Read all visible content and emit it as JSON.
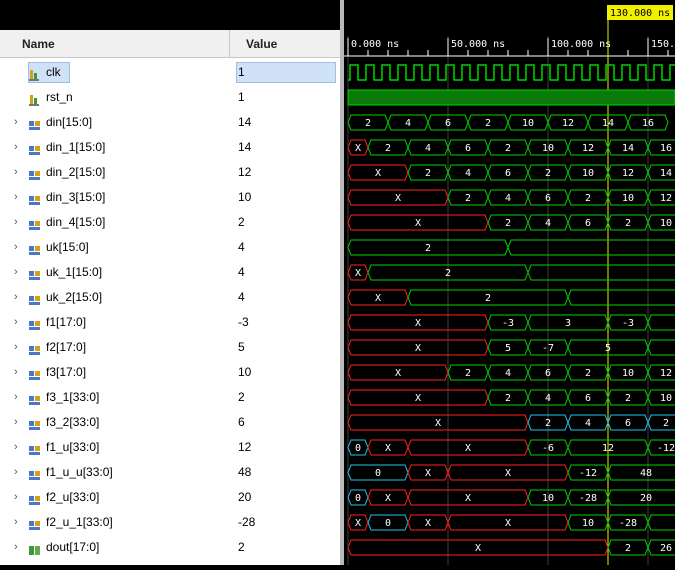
{
  "headers": {
    "name": "Name",
    "value": "Value"
  },
  "cursor_time": "130.000 ns",
  "time_ticks": [
    "0.000 ns",
    "50.000 ns",
    "100.000 ns",
    "150."
  ],
  "colors": {
    "wave_green": "#00d400",
    "wave_red": "#ff2020",
    "wave_cyan": "#21c8e6",
    "cursor_yellow": "#f0f000",
    "grid": "#3c3c3c"
  },
  "signals": [
    {
      "name": "clk",
      "value": "1",
      "icon": "bit-signal-icon",
      "expandable": false,
      "selected": true,
      "wave": {
        "kind": "clock",
        "period": 8.0,
        "start": 1.0
      }
    },
    {
      "name": "rst_n",
      "value": "1",
      "icon": "bit-signal-icon",
      "expandable": false,
      "wave": {
        "kind": "level"
      }
    },
    {
      "name": "din[15:0]",
      "value": "14",
      "icon": "bus-signal-icon",
      "expandable": true,
      "wave": {
        "kind": "bus",
        "segments": [
          {
            "s": 0,
            "e": 20,
            "v": "2",
            "c": "g"
          },
          {
            "s": 20,
            "e": 40,
            "v": "4",
            "c": "g"
          },
          {
            "s": 40,
            "e": 60,
            "v": "6",
            "c": "g"
          },
          {
            "s": 60,
            "e": 80,
            "v": "2",
            "c": "g"
          },
          {
            "s": 80,
            "e": 100,
            "v": "10",
            "c": "g"
          },
          {
            "s": 100,
            "e": 120,
            "v": "12",
            "c": "g"
          },
          {
            "s": 120,
            "e": 140,
            "v": "14",
            "c": "g"
          },
          {
            "s": 140,
            "e": 160,
            "v": "16",
            "c": "g"
          }
        ]
      }
    },
    {
      "name": "din_1[15:0]",
      "value": "14",
      "icon": "bus-signal-icon",
      "expandable": true,
      "wave": {
        "kind": "bus",
        "segments": [
          {
            "s": 0,
            "e": 10,
            "v": "X",
            "c": "r"
          },
          {
            "s": 10,
            "e": 30,
            "v": "2",
            "c": "g"
          },
          {
            "s": 30,
            "e": 50,
            "v": "4",
            "c": "g"
          },
          {
            "s": 50,
            "e": 70,
            "v": "6",
            "c": "g"
          },
          {
            "s": 70,
            "e": 90,
            "v": "2",
            "c": "g"
          },
          {
            "s": 90,
            "e": 110,
            "v": "10",
            "c": "g"
          },
          {
            "s": 110,
            "e": 130,
            "v": "12",
            "c": "g"
          },
          {
            "s": 130,
            "e": 150,
            "v": "14",
            "c": "g"
          },
          {
            "s": 150,
            "e": 170,
            "v": "16",
            "c": "g"
          }
        ]
      }
    },
    {
      "name": "din_2[15:0]",
      "value": "12",
      "icon": "bus-signal-icon",
      "expandable": true,
      "wave": {
        "kind": "bus",
        "segments": [
          {
            "s": 0,
            "e": 30,
            "v": "X",
            "c": "r"
          },
          {
            "s": 30,
            "e": 50,
            "v": "2",
            "c": "g"
          },
          {
            "s": 50,
            "e": 70,
            "v": "4",
            "c": "g"
          },
          {
            "s": 70,
            "e": 90,
            "v": "6",
            "c": "g"
          },
          {
            "s": 90,
            "e": 110,
            "v": "2",
            "c": "g"
          },
          {
            "s": 110,
            "e": 130,
            "v": "10",
            "c": "g"
          },
          {
            "s": 130,
            "e": 150,
            "v": "12",
            "c": "g"
          },
          {
            "s": 150,
            "e": 170,
            "v": "14",
            "c": "g"
          }
        ]
      }
    },
    {
      "name": "din_3[15:0]",
      "value": "10",
      "icon": "bus-signal-icon",
      "expandable": true,
      "wave": {
        "kind": "bus",
        "segments": [
          {
            "s": 0,
            "e": 50,
            "v": "X",
            "c": "r"
          },
          {
            "s": 50,
            "e": 70,
            "v": "2",
            "c": "g"
          },
          {
            "s": 70,
            "e": 90,
            "v": "4",
            "c": "g"
          },
          {
            "s": 90,
            "e": 110,
            "v": "6",
            "c": "g"
          },
          {
            "s": 110,
            "e": 130,
            "v": "2",
            "c": "g"
          },
          {
            "s": 130,
            "e": 150,
            "v": "10",
            "c": "g"
          },
          {
            "s": 150,
            "e": 170,
            "v": "12",
            "c": "g"
          }
        ]
      }
    },
    {
      "name": "din_4[15:0]",
      "value": "2",
      "icon": "bus-signal-icon",
      "expandable": true,
      "wave": {
        "kind": "bus",
        "segments": [
          {
            "s": 0,
            "e": 70,
            "v": "X",
            "c": "r"
          },
          {
            "s": 70,
            "e": 90,
            "v": "2",
            "c": "g"
          },
          {
            "s": 90,
            "e": 110,
            "v": "4",
            "c": "g"
          },
          {
            "s": 110,
            "e": 130,
            "v": "6",
            "c": "g"
          },
          {
            "s": 130,
            "e": 150,
            "v": "2",
            "c": "g"
          },
          {
            "s": 150,
            "e": 170,
            "v": "10",
            "c": "g"
          }
        ]
      }
    },
    {
      "name": "uk[15:0]",
      "value": "4",
      "icon": "bus-signal-icon",
      "expandable": true,
      "wave": {
        "kind": "bus",
        "segments": [
          {
            "s": 0,
            "e": 80,
            "v": "2",
            "c": "g"
          },
          {
            "s": 80,
            "e": 170,
            "v": "",
            "c": "g"
          }
        ]
      }
    },
    {
      "name": "uk_1[15:0]",
      "value": "4",
      "icon": "bus-signal-icon",
      "expandable": true,
      "wave": {
        "kind": "bus",
        "segments": [
          {
            "s": 0,
            "e": 10,
            "v": "X",
            "c": "r"
          },
          {
            "s": 10,
            "e": 90,
            "v": "2",
            "c": "g"
          },
          {
            "s": 90,
            "e": 170,
            "v": "",
            "c": "g"
          }
        ]
      }
    },
    {
      "name": "uk_2[15:0]",
      "value": "4",
      "icon": "bus-signal-icon",
      "expandable": true,
      "wave": {
        "kind": "bus",
        "segments": [
          {
            "s": 0,
            "e": 30,
            "v": "X",
            "c": "r"
          },
          {
            "s": 30,
            "e": 110,
            "v": "2",
            "c": "g"
          },
          {
            "s": 110,
            "e": 170,
            "v": "",
            "c": "g"
          }
        ]
      }
    },
    {
      "name": "f1[17:0]",
      "value": "-3",
      "icon": "bus-signal-icon",
      "expandable": true,
      "wave": {
        "kind": "bus",
        "segments": [
          {
            "s": 0,
            "e": 70,
            "v": "X",
            "c": "r"
          },
          {
            "s": 70,
            "e": 90,
            "v": "-3",
            "c": "g"
          },
          {
            "s": 90,
            "e": 130,
            "v": "3",
            "c": "g"
          },
          {
            "s": 130,
            "e": 150,
            "v": "-3",
            "c": "g"
          },
          {
            "s": 150,
            "e": 170,
            "v": "",
            "c": "g"
          }
        ]
      }
    },
    {
      "name": "f2[17:0]",
      "value": "5",
      "icon": "bus-signal-icon",
      "expandable": true,
      "wave": {
        "kind": "bus",
        "segments": [
          {
            "s": 0,
            "e": 70,
            "v": "X",
            "c": "r"
          },
          {
            "s": 70,
            "e": 90,
            "v": "5",
            "c": "g"
          },
          {
            "s": 90,
            "e": 110,
            "v": "-7",
            "c": "g"
          },
          {
            "s": 110,
            "e": 150,
            "v": "5",
            "c": "g"
          },
          {
            "s": 150,
            "e": 170,
            "v": "",
            "c": "g"
          }
        ]
      }
    },
    {
      "name": "f3[17:0]",
      "value": "10",
      "icon": "bus-signal-icon",
      "expandable": true,
      "wave": {
        "kind": "bus",
        "segments": [
          {
            "s": 0,
            "e": 50,
            "v": "X",
            "c": "r"
          },
          {
            "s": 50,
            "e": 70,
            "v": "2",
            "c": "g"
          },
          {
            "s": 70,
            "e": 90,
            "v": "4",
            "c": "g"
          },
          {
            "s": 90,
            "e": 110,
            "v": "6",
            "c": "g"
          },
          {
            "s": 110,
            "e": 130,
            "v": "2",
            "c": "g"
          },
          {
            "s": 130,
            "e": 150,
            "v": "10",
            "c": "g"
          },
          {
            "s": 150,
            "e": 170,
            "v": "12",
            "c": "g"
          }
        ]
      }
    },
    {
      "name": "f3_1[33:0]",
      "value": "2",
      "icon": "bus-signal-icon",
      "expandable": true,
      "wave": {
        "kind": "bus",
        "segments": [
          {
            "s": 0,
            "e": 70,
            "v": "X",
            "c": "r"
          },
          {
            "s": 70,
            "e": 90,
            "v": "2",
            "c": "g"
          },
          {
            "s": 90,
            "e": 110,
            "v": "4",
            "c": "g"
          },
          {
            "s": 110,
            "e": 130,
            "v": "6",
            "c": "g"
          },
          {
            "s": 130,
            "e": 150,
            "v": "2",
            "c": "g"
          },
          {
            "s": 150,
            "e": 170,
            "v": "10",
            "c": "g"
          }
        ]
      }
    },
    {
      "name": "f3_2[33:0]",
      "value": "6",
      "icon": "bus-signal-icon",
      "expandable": true,
      "wave": {
        "kind": "bus",
        "segments": [
          {
            "s": 0,
            "e": 90,
            "v": "X",
            "c": "r"
          },
          {
            "s": 90,
            "e": 110,
            "v": "2",
            "c": "c"
          },
          {
            "s": 110,
            "e": 130,
            "v": "4",
            "c": "c"
          },
          {
            "s": 130,
            "e": 150,
            "v": "6",
            "c": "c"
          },
          {
            "s": 150,
            "e": 170,
            "v": "2",
            "c": "c"
          }
        ]
      }
    },
    {
      "name": "f1_u[33:0]",
      "value": "12",
      "icon": "bus-signal-icon",
      "expandable": true,
      "wave": {
        "kind": "bus",
        "segments": [
          {
            "s": 0,
            "e": 10,
            "v": "0",
            "c": "c"
          },
          {
            "s": 10,
            "e": 30,
            "v": "X",
            "c": "r"
          },
          {
            "s": 30,
            "e": 90,
            "v": "X",
            "c": "r"
          },
          {
            "s": 90,
            "e": 110,
            "v": "-6",
            "c": "g"
          },
          {
            "s": 110,
            "e": 150,
            "v": "12",
            "c": "g"
          },
          {
            "s": 150,
            "e": 170,
            "v": "-12",
            "c": "g"
          }
        ]
      }
    },
    {
      "name": "f1_u_u[33:0]",
      "value": "48",
      "icon": "bus-signal-icon",
      "expandable": true,
      "wave": {
        "kind": "bus",
        "segments": [
          {
            "s": 0,
            "e": 30,
            "v": "0",
            "c": "c"
          },
          {
            "s": 30,
            "e": 50,
            "v": "X",
            "c": "r"
          },
          {
            "s": 50,
            "e": 110,
            "v": "X",
            "c": "r"
          },
          {
            "s": 110,
            "e": 130,
            "v": "-12",
            "c": "g"
          },
          {
            "s": 130,
            "e": 170,
            "v": "48",
            "c": "g"
          }
        ]
      }
    },
    {
      "name": "f2_u[33:0]",
      "value": "20",
      "icon": "bus-signal-icon",
      "expandable": true,
      "wave": {
        "kind": "bus",
        "segments": [
          {
            "s": 0,
            "e": 10,
            "v": "0",
            "c": "c"
          },
          {
            "s": 10,
            "e": 30,
            "v": "X",
            "c": "r"
          },
          {
            "s": 30,
            "e": 90,
            "v": "X",
            "c": "r"
          },
          {
            "s": 90,
            "e": 110,
            "v": "10",
            "c": "g"
          },
          {
            "s": 110,
            "e": 130,
            "v": "-28",
            "c": "g"
          },
          {
            "s": 130,
            "e": 170,
            "v": "20",
            "c": "g"
          }
        ]
      }
    },
    {
      "name": "f2_u_1[33:0]",
      "value": "-28",
      "icon": "bus-signal-icon",
      "expandable": true,
      "wave": {
        "kind": "bus",
        "segments": [
          {
            "s": 0,
            "e": 10,
            "v": "X",
            "c": "r"
          },
          {
            "s": 10,
            "e": 30,
            "v": "0",
            "c": "c"
          },
          {
            "s": 30,
            "e": 50,
            "v": "X",
            "c": "r"
          },
          {
            "s": 50,
            "e": 110,
            "v": "X",
            "c": "r"
          },
          {
            "s": 110,
            "e": 130,
            "v": "10",
            "c": "g"
          },
          {
            "s": 130,
            "e": 150,
            "v": "-28",
            "c": "g"
          },
          {
            "s": 150,
            "e": 170,
            "v": "",
            "c": "g"
          }
        ]
      }
    },
    {
      "name": "dout[17:0]",
      "value": "2",
      "icon": "output-bus-icon",
      "expandable": true,
      "wave": {
        "kind": "bus",
        "segments": [
          {
            "s": 0,
            "e": 130,
            "v": "X",
            "c": "r"
          },
          {
            "s": 130,
            "e": 150,
            "v": "2",
            "c": "g"
          },
          {
            "s": 150,
            "e": 170,
            "v": "26",
            "c": "g"
          }
        ]
      }
    }
  ]
}
